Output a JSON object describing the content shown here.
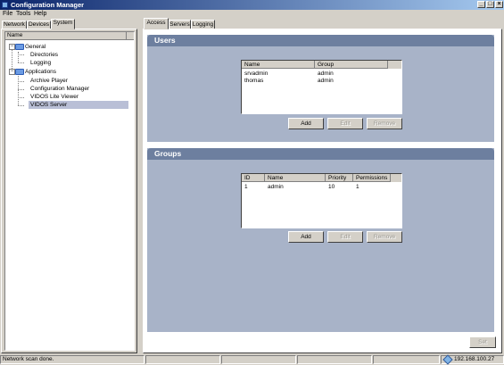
{
  "window": {
    "title": "Configuration Manager",
    "minimize": "_",
    "maximize": "□",
    "close": "×"
  },
  "menu": {
    "items": [
      "File",
      "Tools",
      "Help"
    ]
  },
  "left_tabs": [
    {
      "label": "Network",
      "active": false
    },
    {
      "label": "Devices",
      "active": false
    },
    {
      "label": "System",
      "active": true
    }
  ],
  "tree": {
    "column_header": "Name",
    "nodes": [
      {
        "label": "General",
        "type": "folder",
        "expanded": true,
        "expander": "−"
      },
      {
        "label": "Directories",
        "type": "leaf"
      },
      {
        "label": "Logging",
        "type": "leaf"
      },
      {
        "label": "Applications",
        "type": "folder",
        "expanded": true,
        "expander": "−"
      },
      {
        "label": "Archive Player",
        "type": "leaf"
      },
      {
        "label": "Configuration Manager",
        "type": "leaf"
      },
      {
        "label": "VIDOS Lite Viewer",
        "type": "leaf"
      },
      {
        "label": "VIDOS Server",
        "type": "leaf",
        "selected": true
      }
    ]
  },
  "right_tabs": [
    {
      "label": "Access",
      "active": true
    },
    {
      "label": "Servers",
      "active": false
    },
    {
      "label": "Logging",
      "active": false
    }
  ],
  "users": {
    "title": "Users",
    "columns": [
      "Name",
      "Group"
    ],
    "rows": [
      [
        "srvadmin",
        "admin"
      ],
      [
        "thomas",
        "admin"
      ]
    ],
    "buttons": {
      "add": "Add",
      "edit": "Edit",
      "remove": "Remove"
    }
  },
  "groups": {
    "title": "Groups",
    "columns": [
      "ID",
      "Name",
      "Priority",
      "Permissions"
    ],
    "rows": [
      [
        "1",
        "admin",
        "10",
        "1"
      ]
    ],
    "buttons": {
      "add": "Add",
      "edit": "Edit",
      "remove": "Remove"
    }
  },
  "set_button": "Set",
  "status": {
    "message": "Network scan done.",
    "ip": "192.168.100.27"
  },
  "colors": {
    "section_header": "#6d7f9f",
    "section_body": "#a8b3c8",
    "selection": "#b9bfd6",
    "titlebar": "#0a246a"
  }
}
